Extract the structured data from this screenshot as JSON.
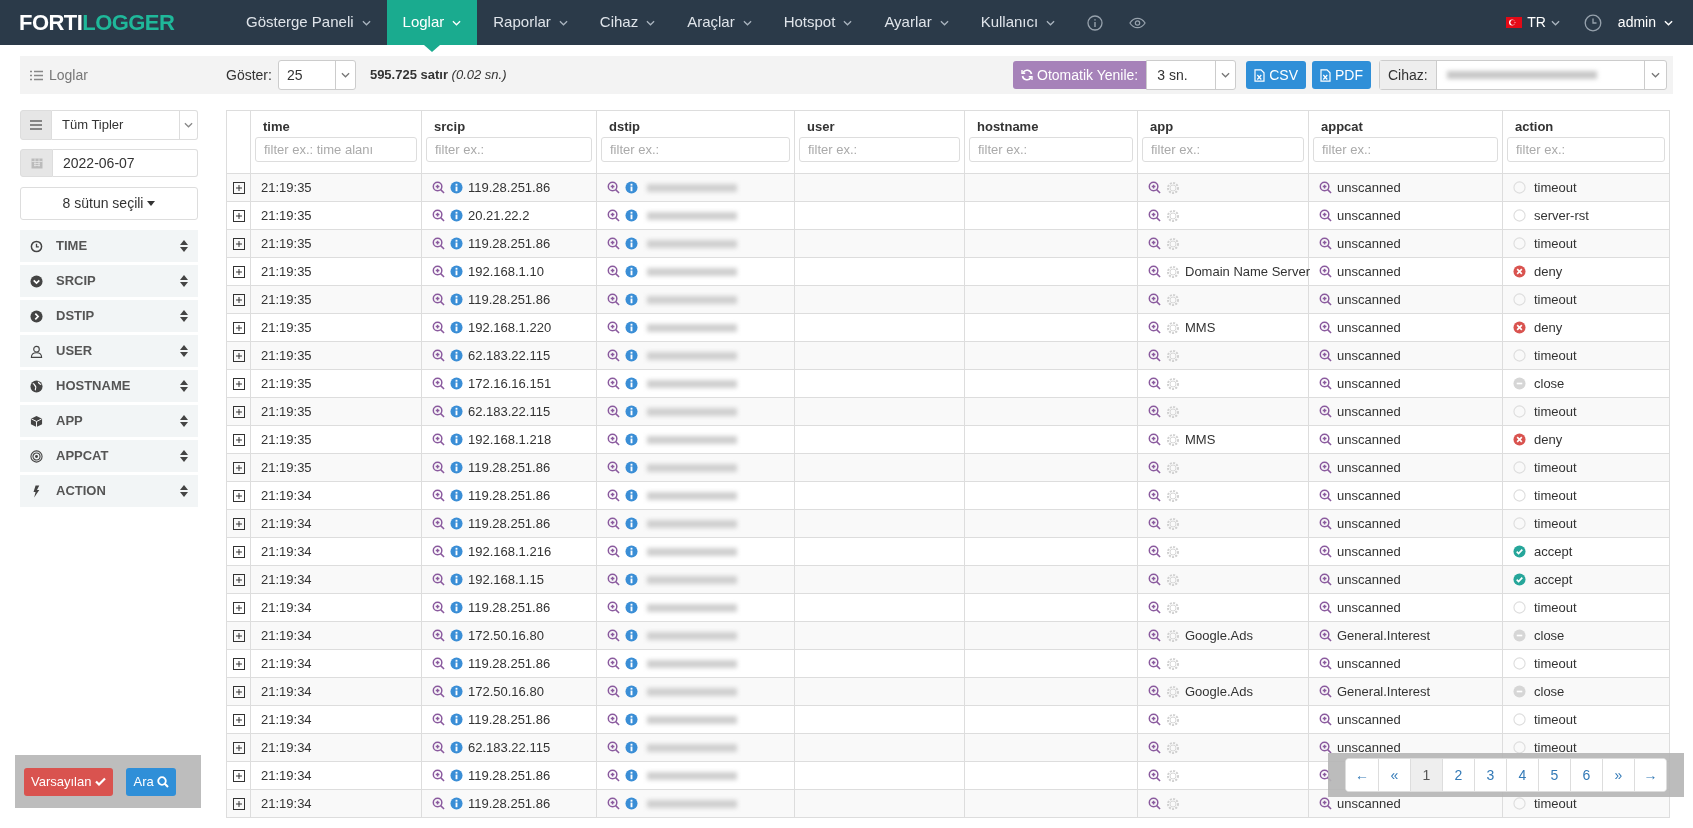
{
  "navbar": {
    "logo": {
      "part1": "FORTI",
      "part2": "LOGGER"
    },
    "items": [
      {
        "label": "Gösterge Paneli",
        "selected": false
      },
      {
        "label": "Loglar",
        "selected": true
      },
      {
        "label": "Raporlar",
        "selected": false
      },
      {
        "label": "Cihaz",
        "selected": false
      },
      {
        "label": "Araçlar",
        "selected": false
      },
      {
        "label": "Hotspot",
        "selected": false
      },
      {
        "label": "Ayarlar",
        "selected": false
      },
      {
        "label": "Kullanıcı",
        "selected": false
      }
    ],
    "language": "TR",
    "user": "admin"
  },
  "toolbar": {
    "title": "Loglar",
    "show_label": "Göster:",
    "show_value": "25",
    "summary": "**595.725 satır** *(0.02 sn.)*",
    "auto_refresh_label": "Otomatik Yenile:",
    "auto_refresh_value": "3 sn.",
    "buttons": [
      "CSV",
      "PDF"
    ],
    "device_label": "Cihaz:"
  },
  "sidebar": {
    "type_select": "Tüm Tipler",
    "date": "2022-06-07",
    "columns_button": "8 sütun seçili",
    "fields": [
      {
        "label": "TIME",
        "kind": "clock"
      },
      {
        "label": "SRCIP",
        "kind": "down"
      },
      {
        "label": "DSTIP",
        "kind": "right"
      },
      {
        "label": "USER",
        "kind": "user"
      },
      {
        "label": "HOSTNAME",
        "kind": "globe"
      },
      {
        "label": "APP",
        "kind": "cube"
      },
      {
        "label": "APPCAT",
        "kind": "target"
      },
      {
        "label": "ACTION",
        "kind": "bolt"
      }
    ],
    "buttons": [
      {
        "label": "Varsayılan",
        "kind": "default"
      },
      {
        "label": "Ara",
        "kind": "search"
      }
    ]
  },
  "table": {
    "columns": [
      {
        "name": "time",
        "placeholder": "filter ex.: time alanı"
      },
      {
        "name": "srcip",
        "placeholder": "filter ex.:"
      },
      {
        "name": "dstip",
        "placeholder": "filter ex.:"
      },
      {
        "name": "user",
        "placeholder": "filter ex.:"
      },
      {
        "name": "hostname",
        "placeholder": "filter ex.:"
      },
      {
        "name": "app",
        "placeholder": "filter ex.:"
      },
      {
        "name": "appcat",
        "placeholder": "filter ex.:"
      },
      {
        "name": "action",
        "placeholder": "filter ex.:"
      }
    ],
    "rows": [
      {
        "time": "21:19:35",
        "srcip": "119.28.251.86",
        "appcat": "unscanned",
        "action": {
          "text": "timeout",
          "kind": "none"
        }
      },
      {
        "time": "21:19:35",
        "srcip": "20.21.22.2",
        "appcat": "unscanned",
        "action": {
          "text": "server-rst",
          "kind": "none"
        }
      },
      {
        "time": "21:19:35",
        "srcip": "119.28.251.86",
        "appcat": "unscanned",
        "action": {
          "text": "timeout",
          "kind": "none"
        }
      },
      {
        "time": "21:19:35",
        "srcip": "192.168.1.10",
        "app": "Domain Name Server",
        "appcat": "unscanned",
        "action": {
          "text": "deny",
          "kind": "deny"
        }
      },
      {
        "time": "21:19:35",
        "srcip": "119.28.251.86",
        "appcat": "unscanned",
        "action": {
          "text": "timeout",
          "kind": "none"
        }
      },
      {
        "time": "21:19:35",
        "srcip": "192.168.1.220",
        "app": "MMS",
        "appcat": "unscanned",
        "action": {
          "text": "deny",
          "kind": "deny"
        }
      },
      {
        "time": "21:19:35",
        "srcip": "62.183.22.115",
        "appcat": "unscanned",
        "action": {
          "text": "timeout",
          "kind": "none"
        }
      },
      {
        "time": "21:19:35",
        "srcip": "172.16.16.151",
        "appcat": "unscanned",
        "action": {
          "text": "close",
          "kind": "close"
        }
      },
      {
        "time": "21:19:35",
        "srcip": "62.183.22.115",
        "appcat": "unscanned",
        "action": {
          "text": "timeout",
          "kind": "none"
        }
      },
      {
        "time": "21:19:35",
        "srcip": "192.168.1.218",
        "app": "MMS",
        "appcat": "unscanned",
        "action": {
          "text": "deny",
          "kind": "deny"
        }
      },
      {
        "time": "21:19:35",
        "srcip": "119.28.251.86",
        "appcat": "unscanned",
        "action": {
          "text": "timeout",
          "kind": "none"
        }
      },
      {
        "time": "21:19:34",
        "srcip": "119.28.251.86",
        "appcat": "unscanned",
        "action": {
          "text": "timeout",
          "kind": "none"
        }
      },
      {
        "time": "21:19:34",
        "srcip": "119.28.251.86",
        "appcat": "unscanned",
        "action": {
          "text": "timeout",
          "kind": "none"
        }
      },
      {
        "time": "21:19:34",
        "srcip": "192.168.1.216",
        "appcat": "unscanned",
        "action": {
          "text": "accept",
          "kind": "accept"
        }
      },
      {
        "time": "21:19:34",
        "srcip": "192.168.1.15",
        "appcat": "unscanned",
        "action": {
          "text": "accept",
          "kind": "accept"
        }
      },
      {
        "time": "21:19:34",
        "srcip": "119.28.251.86",
        "appcat": "unscanned",
        "action": {
          "text": "timeout",
          "kind": "none"
        }
      },
      {
        "time": "21:19:34",
        "srcip": "172.50.16.80",
        "app": "Google.Ads",
        "appcat": "General.Interest",
        "action": {
          "text": "close",
          "kind": "close"
        }
      },
      {
        "time": "21:19:34",
        "srcip": "119.28.251.86",
        "appcat": "unscanned",
        "action": {
          "text": "timeout",
          "kind": "none"
        }
      },
      {
        "time": "21:19:34",
        "srcip": "172.50.16.80",
        "app": "Google.Ads",
        "appcat": "General.Interest",
        "action": {
          "text": "close",
          "kind": "close"
        }
      },
      {
        "time": "21:19:34",
        "srcip": "119.28.251.86",
        "appcat": "unscanned",
        "action": {
          "text": "timeout",
          "kind": "none"
        }
      },
      {
        "time": "21:19:34",
        "srcip": "62.183.22.115",
        "appcat": "unscanned",
        "action": {
          "text": "timeout",
          "kind": "none"
        }
      },
      {
        "time": "21:19:34",
        "srcip": "119.28.251.86"
      },
      {
        "time": "21:19:34",
        "srcip": "119.28.251.86",
        "appcat": "unscanned",
        "action": {
          "text": "timeout",
          "kind": "none"
        }
      }
    ]
  },
  "pagination": [
    {
      "label": "←",
      "selected": false
    },
    {
      "label": "«",
      "selected": false
    },
    {
      "label": "1",
      "selected": true
    },
    {
      "label": "2",
      "selected": false
    },
    {
      "label": "3",
      "selected": false
    },
    {
      "label": "4",
      "selected": false
    },
    {
      "label": "5",
      "selected": false
    },
    {
      "label": "6",
      "selected": false
    },
    {
      "label": "»",
      "selected": false
    },
    {
      "label": "→",
      "selected": false
    }
  ]
}
